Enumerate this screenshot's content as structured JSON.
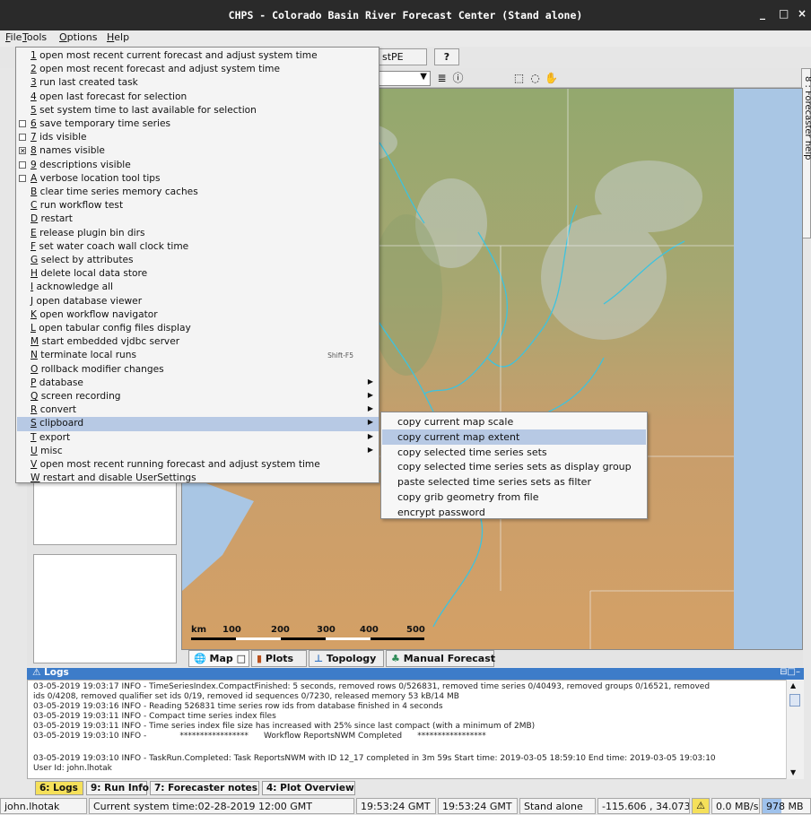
{
  "window": {
    "title": "CHPS - Colorado Basin River Forecast Center  (Stand alone)",
    "minimize_glyph": "_",
    "maximize_glyph": "□",
    "close_glyph": "×"
  },
  "menubar": {
    "items": [
      {
        "key": "F",
        "rest": "ile"
      },
      {
        "key": "T",
        "rest": "ools"
      },
      {
        "key": "O",
        "rest": "ptions"
      },
      {
        "key": "H",
        "rest": "elp"
      }
    ]
  },
  "toolbar": {
    "partial_button": "stPE",
    "help_button": "?"
  },
  "options_menu": {
    "items": [
      {
        "key": "1",
        "rest": " open most recent current forecast and adjust system time"
      },
      {
        "key": "2",
        "rest": " open most recent forecast and adjust system time"
      },
      {
        "key": "3",
        "rest": " run last created task"
      },
      {
        "key": "4",
        "rest": " open last forecast for selection"
      },
      {
        "key": "5",
        "rest": " set system time to last available for selection"
      },
      {
        "key": "6",
        "rest": " save temporary time series",
        "check": "off"
      },
      {
        "key": "7",
        "rest": " ids visible",
        "check": "off"
      },
      {
        "key": "8",
        "rest": " names visible",
        "check": "on"
      },
      {
        "key": "9",
        "rest": " descriptions visible",
        "check": "off"
      },
      {
        "key": "A",
        "rest": " verbose location tool tips",
        "check": "off"
      },
      {
        "key": "B",
        "rest": " clear time series memory caches"
      },
      {
        "key": "C",
        "rest": " run workflow test"
      },
      {
        "key": "D",
        "rest": " restart"
      },
      {
        "key": "E",
        "rest": " release plugin bin dirs"
      },
      {
        "key": "F",
        "rest": " set water coach wall clock time"
      },
      {
        "key": "G",
        "rest": " select by attributes"
      },
      {
        "key": "H",
        "rest": " delete local data store"
      },
      {
        "key": "I",
        "rest": " acknowledge all"
      },
      {
        "key": "J",
        "rest": " open database viewer"
      },
      {
        "key": "K",
        "rest": " open workflow navigator"
      },
      {
        "key": "L",
        "rest": " open tabular config files display"
      },
      {
        "key": "M",
        "rest": " start embedded vjdbc server"
      },
      {
        "key": "N",
        "rest": " terminate local runs",
        "shortcut": "Shift-F5"
      },
      {
        "key": "O",
        "rest": " rollback modifier changes"
      },
      {
        "key": "P",
        "rest": " database",
        "submenu": true
      },
      {
        "key": "Q",
        "rest": " screen recording",
        "submenu": true
      },
      {
        "key": "R",
        "rest": " convert",
        "submenu": true
      },
      {
        "key": "S",
        "rest": " clipboard",
        "submenu": true,
        "highlighted": true
      },
      {
        "key": "T",
        "rest": " export",
        "submenu": true
      },
      {
        "key": "U",
        "rest": " misc",
        "submenu": true
      },
      {
        "key": "V",
        "rest": " open most recent running forecast and adjust system time"
      },
      {
        "key": "W",
        "rest": " restart and disable UserSettings"
      }
    ]
  },
  "clipboard_submenu": {
    "items": [
      {
        "label": "copy current map scale"
      },
      {
        "label": "copy current map extent",
        "highlighted": true
      },
      {
        "label": "copy selected time series sets"
      },
      {
        "label": "copy selected time series sets as display group"
      },
      {
        "label": "paste selected time series sets as filter"
      },
      {
        "label": "copy grib geometry from file"
      },
      {
        "label": "encrypt password"
      }
    ]
  },
  "side_tab": {
    "label": "8 : Forecaster help"
  },
  "map": {
    "scale_unit": "km",
    "scale_labels": [
      "100",
      "200",
      "300",
      "400",
      "500"
    ],
    "water_color": "#a9c6e4",
    "terrain_color": "#c9a06e",
    "river_color": "#3cc3df"
  },
  "view_tabs": [
    {
      "label": "Map",
      "icon": "globe-icon",
      "extra": "□",
      "active": true
    },
    {
      "label": "Plots",
      "icon": "plot-icon"
    },
    {
      "label": "Topology",
      "icon": "topology-icon"
    },
    {
      "label": "Manual Forecast",
      "icon": "manual-forecast-icon"
    }
  ],
  "logs": {
    "title": "Logs",
    "header_controls": "⊟□–",
    "lines": [
      "03-05-2019 19:03:17 INFO - TimeSeriesIndex.CompactFinished: 5 seconds, removed rows 0/526831, removed time series 0/40493, removed groups 0/16521, removed",
      "ids 0/4208, removed qualifier set ids 0/19, removed id sequences 0/7230, released memory 53 kB/14 MB",
      "03-05-2019 19:03:16 INFO - Reading 526831 time series row ids from database finished in 4 seconds",
      "03-05-2019 19:03:11 INFO - Compact time series index files",
      "03-05-2019 19:03:11 INFO - Time series index file size has increased with 25% since last compact (with a minimum of 2MB)",
      "03-05-2019 19:03:10 INFO -             *****************      Workflow ReportsNWM Completed      *****************",
      "",
      "03-05-2019 19:03:10 INFO - TaskRun.Completed: Task  ReportsNWM with ID 12_17 completed in 3m 59s Start time: 2019-03-05 18:59:10 End time: 2019-03-05 19:03:10",
      "User Id: john.lhotak"
    ]
  },
  "panel_tabs": [
    {
      "label": "6: Logs",
      "active": true
    },
    {
      "label": "9: Run Info"
    },
    {
      "label": "7: Forecaster notes"
    },
    {
      "label": "4: Plot Overview"
    }
  ],
  "status": {
    "user": "john.lhotak",
    "system_time": "Current system time:02-28-2019 12:00 GMT",
    "time1": "19:53:24 GMT",
    "time2": "19:53:24 GMT",
    "mode": "Stand alone",
    "coords": "-115.606 , 34.073",
    "rate": "0.0 MB/s",
    "memory": "978 MB"
  }
}
